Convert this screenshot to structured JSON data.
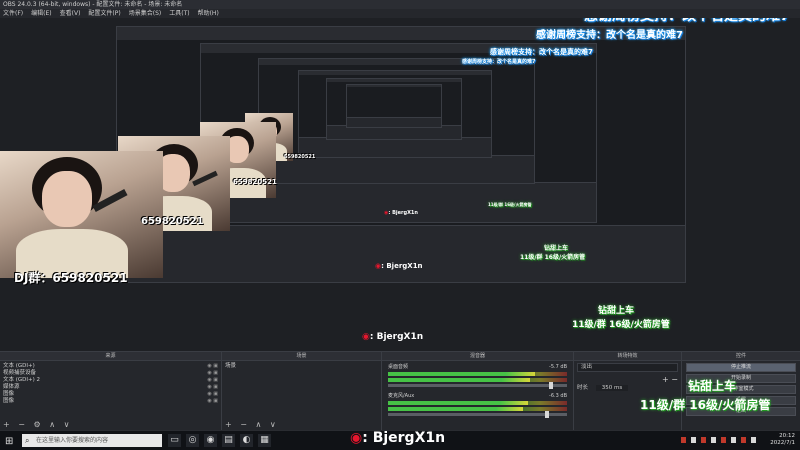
{
  "window": {
    "title": "OBS 24.0.3 (64-bit, windows) - 配置文件: 未命名 - 场景: 未命名"
  },
  "menu": [
    "文件(F)",
    "编辑(E)",
    "查看(V)",
    "配置文件(P)",
    "场景集合(S)",
    "工具(T)",
    "帮助(H)"
  ],
  "overlay": {
    "thanks": "感谢周榜支持：改个名是真的难7",
    "dj_group": "DJ群：659820521",
    "dj_number": "659820521",
    "weibo_handle": ": BjergX1n",
    "weibo_icon": "weibo-icon",
    "bottom_line1": "钻甜上车",
    "bottom_line2": "11级/群 16级/火箭房管"
  },
  "docks": {
    "sources": {
      "title": "来源",
      "items": [
        "文本 (GDI+)",
        "视频捕获设备",
        "文本 (GDI+) 2",
        "媒体源",
        "图像",
        "图像"
      ],
      "toolbar": "+ − ⚙ ∧ ∨"
    },
    "scenes": {
      "title": "场景",
      "items": [
        "场景"
      ],
      "toolbar": "+ − ∧ ∨"
    },
    "mixer": {
      "title": "混音器",
      "channels": [
        {
          "name": "桌面音频",
          "db": "-5.7 dB",
          "level": 0.82,
          "volume": 0.92
        },
        {
          "name": "麦克风/Aux",
          "db": "-6.3 dB",
          "level": 0.78,
          "volume": 0.9
        }
      ]
    },
    "transitions": {
      "title": "转场特效",
      "type": "淡出",
      "duration_label": "时长",
      "duration_value": "350 ms",
      "toolbar": "+ −"
    },
    "controls": {
      "title": "控件",
      "buttons": [
        "停止推流",
        "开始录制",
        "工作室模式",
        "设置",
        "退出"
      ]
    }
  },
  "taskbar": {
    "search_placeholder": "在这里输入你要搜索的内容",
    "time": "20:12",
    "date": "2022/7/1"
  }
}
